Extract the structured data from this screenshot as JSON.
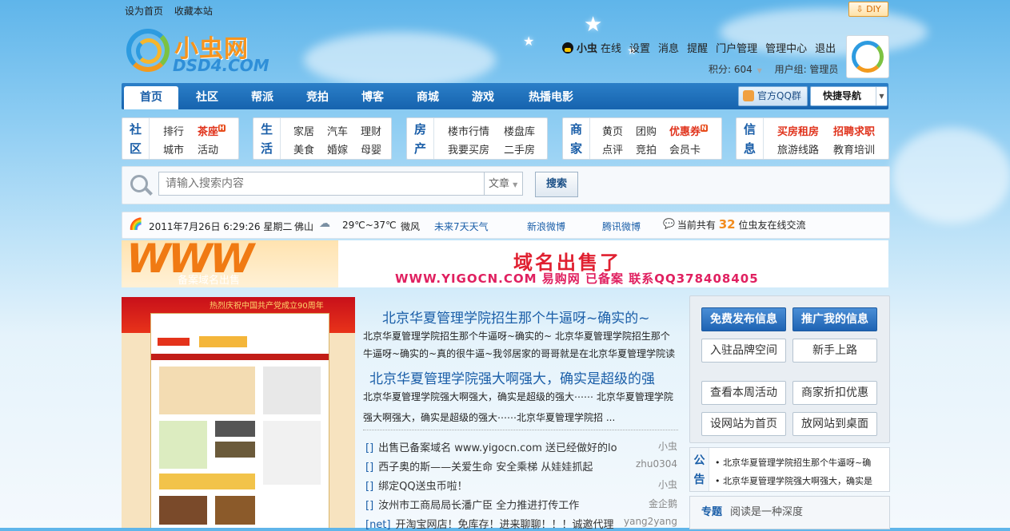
{
  "toplinks": {
    "set_home": "设为首页",
    "favorite": "收藏本站",
    "diy": "DIY"
  },
  "logo": {
    "cn": "小虫网",
    "en": "DSD4.COM"
  },
  "user": {
    "name": "小虫",
    "status": "在线",
    "links": [
      "设置",
      "消息",
      "提醒",
      "门户管理",
      "管理中心",
      "退出"
    ],
    "score_label": "积分: 604",
    "group_label": "用户组: 管理员"
  },
  "nav": {
    "tabs": [
      "首页",
      "社区",
      "帮派",
      "竞拍",
      "博客",
      "商城",
      "游戏",
      "热播电影"
    ],
    "active": "首页",
    "qq_group": "官方QQ群",
    "quick_nav": "快捷导航"
  },
  "categories": [
    {
      "head": [
        "社",
        "区"
      ],
      "links": [
        "排行",
        "茶座",
        "城市",
        "活动"
      ],
      "hot": [
        "茶座"
      ]
    },
    {
      "head": [
        "生",
        "活"
      ],
      "links": [
        "家居",
        "汽车",
        "理财",
        "美食",
        "婚嫁",
        "母婴"
      ],
      "hot": []
    },
    {
      "head": [
        "房",
        "产"
      ],
      "links": [
        "楼市行情",
        "楼盘库",
        "我要买房",
        "二手房"
      ],
      "hot": []
    },
    {
      "head": [
        "商",
        "家"
      ],
      "links": [
        "黄页",
        "团购",
        "优惠券",
        "点评",
        "竞拍",
        "会员卡"
      ],
      "hot": [
        "优惠券"
      ]
    },
    {
      "head": [
        "信",
        "息"
      ],
      "links": [
        "买房租房",
        "招聘求职",
        "旅游线路",
        "教育培训"
      ],
      "hot": [
        "买房租房",
        "招聘求职"
      ]
    }
  ],
  "search": {
    "placeholder": "请输入搜索内容",
    "type": "文章",
    "button": "搜索"
  },
  "infobar": {
    "datetime": "2011年7月26日 6:29:26 星期二",
    "city": "佛山",
    "temp": "29℃~37℃",
    "wind": "微风",
    "forecast": "未来7天天气",
    "sina": "新浪微博",
    "tencent": "腾讯微博",
    "online_pre": "当前共有",
    "online_count": "32",
    "online_post": "位虫友在线交流"
  },
  "banner": {
    "www": "WWW",
    "sub": "备案域名出售",
    "title": "域名出售了",
    "line": "WWW.YIGOCN.COM 易购网 已备案 联系QQ378408405"
  },
  "promo": {
    "header": "热烈庆祝中国共产党成立90周年"
  },
  "news": {
    "headline1": "北京华夏管理学院招生那个牛逼呀~确实的~",
    "summary1a": "北京华夏管理学院招生那个牛逼呀~确实的~ 北京华夏管理学院招生那个",
    "summary1b": "牛逼呀~确实的~真的很牛逼~我邻居家的哥哥就是在北京华夏管理学院读",
    "headline2": "北京华夏管理学院强大啊强大，确实是超级的强",
    "summary2a": "北京华夏管理学院强大啊强大，确实是超级的强大⋯⋯ 北京华夏管理学院",
    "summary2b": "强大啊强大，确实是超级的强大⋯⋯北京华夏管理学院招 ...",
    "list": [
      {
        "tag": "[]",
        "title": "出售已备案域名 www.yigocn.com 送已经做好的lo",
        "author": "小虫"
      },
      {
        "tag": "[]",
        "title": "西子奥的斯——关爱生命 安全乘梯 从娃娃抓起",
        "author": "zhu0304"
      },
      {
        "tag": "[]",
        "title": "绑定QQ送虫币啦！",
        "author": "小虫"
      },
      {
        "tag": "[]",
        "title": "汝州市工商局局长潘广臣 全力推进打传工作",
        "author": "金企鹅"
      },
      {
        "tag": "[net]",
        "title": "开淘宝网店！免库存！进来聊聊！！！诚邀代理",
        "author": "yang2yang"
      }
    ]
  },
  "side": {
    "buttons": [
      "免费发布信息",
      "推广我的信息",
      "入驻品牌空间",
      "新手上路",
      "查看本周活动",
      "商家折扣优惠",
      "设网站为首页",
      "放网站到桌面"
    ]
  },
  "notice": {
    "label": [
      "公",
      "告"
    ],
    "items": [
      "• 北京华夏管理学院招生那个牛逼呀~确",
      "• 北京华夏管理学院强大啊强大，确实是"
    ]
  },
  "topic": {
    "label": "专题",
    "text": "阅读是一种深度"
  }
}
